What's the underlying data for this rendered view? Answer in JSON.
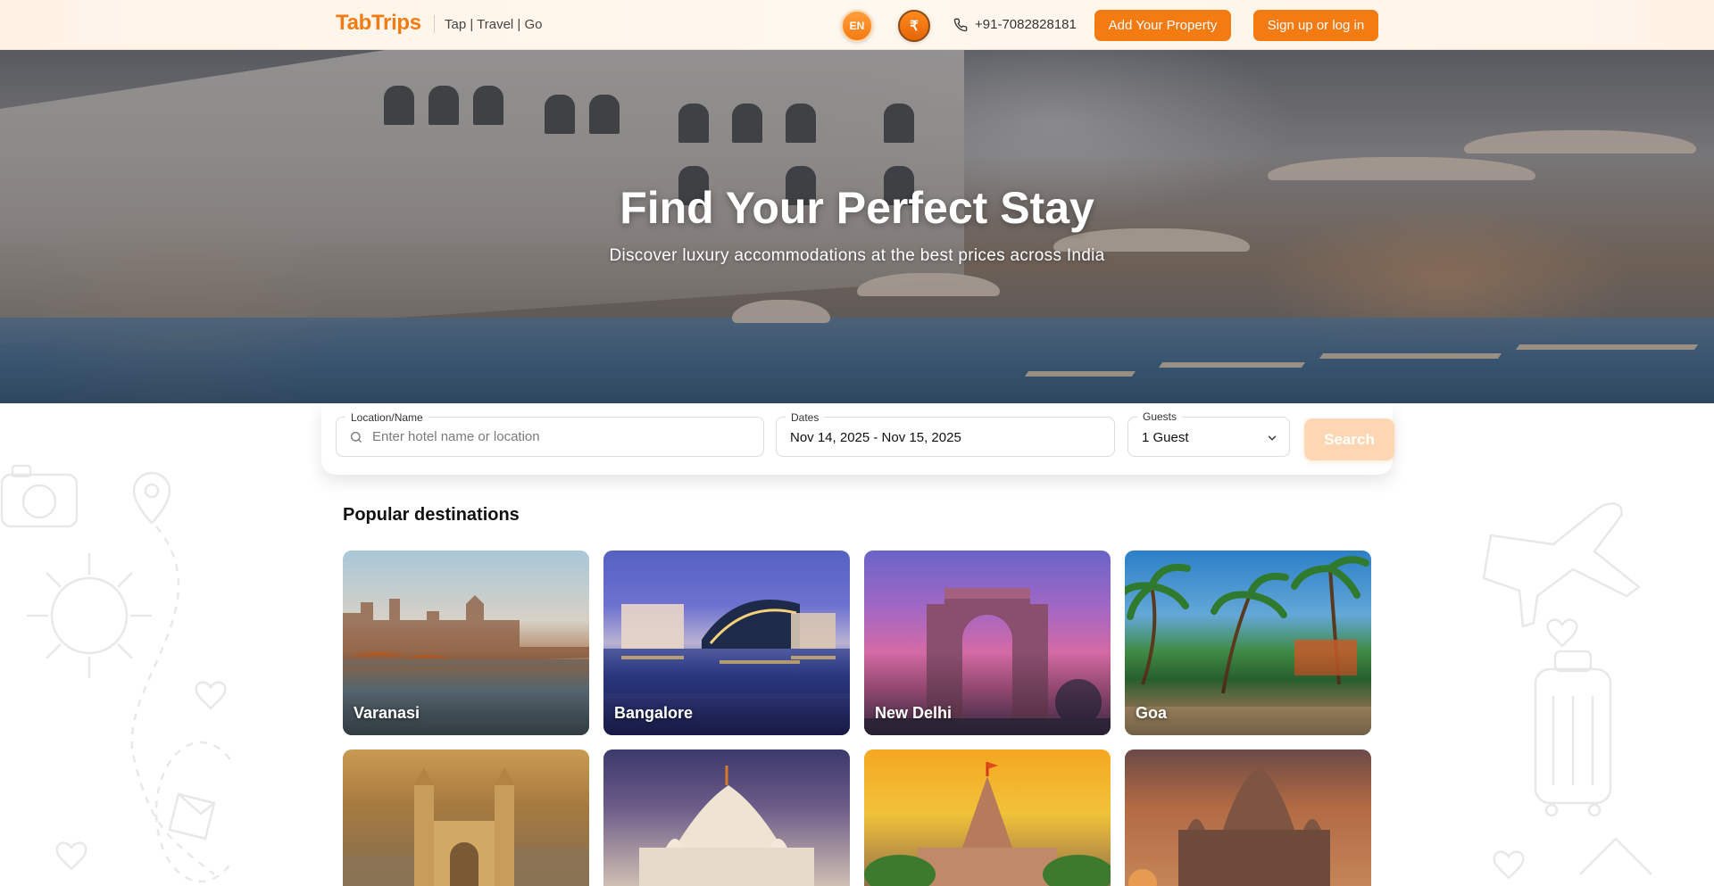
{
  "header": {
    "brand": "TabTrips",
    "tagline": "Tap | Travel | Go",
    "language_label": "EN",
    "currency_symbol": "₹",
    "phone": "+91-7082828181",
    "add_property_label": "Add Your Property",
    "signup_label": "Sign up or log in",
    "accent_color": "#f47a12"
  },
  "hero": {
    "title": "Find Your Perfect Stay",
    "subtitle": "Discover luxury accommodations at the best prices across India"
  },
  "search": {
    "location_label": "Location/Name",
    "location_placeholder": "Enter hotel name or location",
    "location_value": "",
    "dates_label": "Dates",
    "dates_value": "Nov 14, 2025 - Nov 15, 2025",
    "guests_label": "Guests",
    "guests_value": "1 Guest",
    "search_label": "Search"
  },
  "destinations": {
    "title": "Popular destinations",
    "items": [
      {
        "name": "Varanasi"
      },
      {
        "name": "Bangalore"
      },
      {
        "name": "New Delhi"
      },
      {
        "name": "Goa"
      },
      {
        "name": ""
      },
      {
        "name": ""
      },
      {
        "name": ""
      },
      {
        "name": ""
      }
    ]
  },
  "icons": {
    "phone": "phone-icon",
    "search": "search-icon",
    "chevron": "chevron-down-icon"
  }
}
